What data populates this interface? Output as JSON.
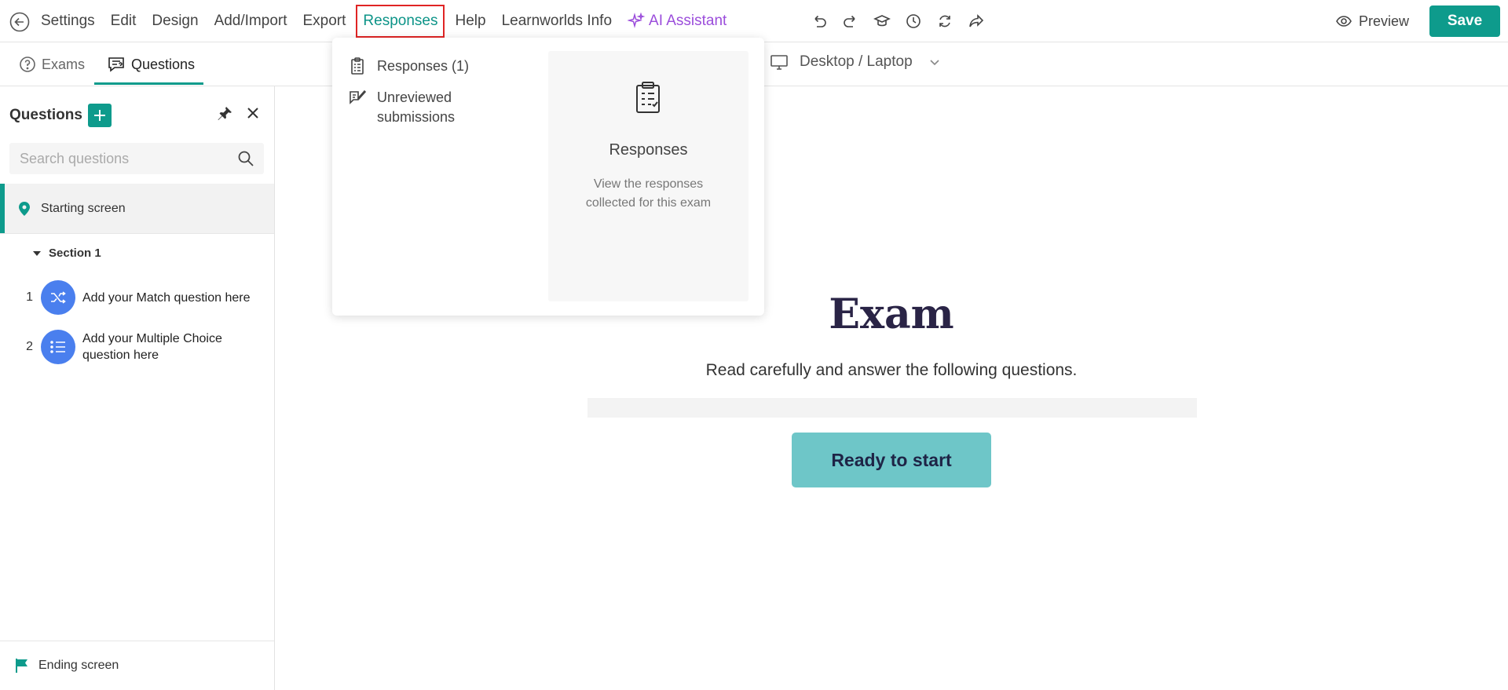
{
  "menu": {
    "items": [
      "Settings",
      "Edit",
      "Design",
      "Add/Import",
      "Export"
    ],
    "active": "Responses",
    "items_after": [
      "Help",
      "Learnworlds Info"
    ],
    "ai_label": "AI Assistant"
  },
  "toolbar": {
    "icons": [
      "undo-icon",
      "redo-icon",
      "graduation-cap-icon",
      "history-icon",
      "refresh-icon",
      "share-icon"
    ],
    "preview_label": "Preview",
    "save_label": "Save"
  },
  "tabs": {
    "exams_label": "Exams",
    "questions_label": "Questions"
  },
  "device": {
    "label": "Desktop / Laptop"
  },
  "sidebar": {
    "title": "Questions",
    "search_placeholder": "Search questions",
    "starting_screen": "Starting screen",
    "section_label": "Section 1",
    "questions": [
      {
        "number": "1",
        "text": "Add your Match question here",
        "icon": "shuffle-icon"
      },
      {
        "number": "2",
        "text": "Add your Multiple Choice question here",
        "icon": "list-icon"
      }
    ],
    "ending_screen": "Ending screen"
  },
  "exam": {
    "title": "Exam",
    "subtitle": "Read carefully and answer the following questions.",
    "start_button": "Ready to start"
  },
  "dropdown": {
    "items": [
      "Responses (1)",
      "Unreviewed submissions"
    ],
    "panel_title": "Responses",
    "panel_description": "View the responses collected for this exam"
  },
  "colors": {
    "accent": "#0e9b8c",
    "ai": "#9b4ddb",
    "question_icon": "#4a7fee",
    "start_button": "#6ec6c8",
    "highlight_outline": "#e02424"
  }
}
